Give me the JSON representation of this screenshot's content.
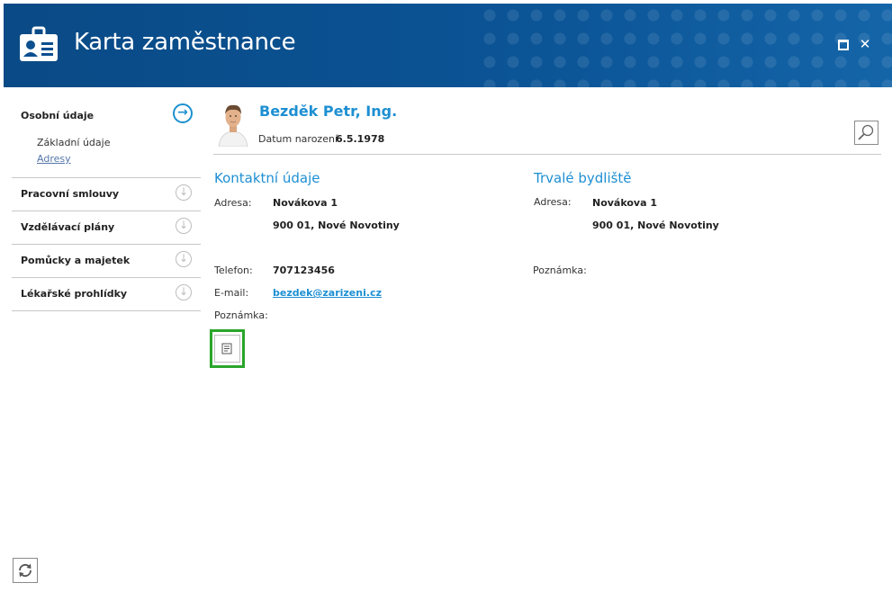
{
  "window": {
    "title": "Karta zaměstnance",
    "maximize_icon": "maximize-icon",
    "close_label": "✕"
  },
  "sidebar": {
    "sections": [
      {
        "label": "Osobní údaje",
        "icon": "arrow-right-circle-icon",
        "active": true,
        "items": [
          {
            "label": "Základní údaje"
          },
          {
            "label": "Adresy"
          }
        ]
      },
      {
        "label": "Pracovní smlouvy",
        "icon": "arrow-down-circle-icon"
      },
      {
        "label": "Vzdělávací plány",
        "icon": "arrow-down-circle-icon"
      },
      {
        "label": "Pomůcky a majetek",
        "icon": "arrow-down-circle-icon"
      },
      {
        "label": "Lékařské prohlídky",
        "icon": "arrow-down-circle-icon"
      }
    ]
  },
  "person": {
    "name": "Bezděk Petr, Ing.",
    "dob_label": "Datum narození:",
    "dob_value": "6.5.1978"
  },
  "contact": {
    "title": "Kontaktní údaje",
    "address_label": "Adresa:",
    "address_line1": "Novákova 1",
    "address_line2": "900 01, Nové Novotiny",
    "phone_label": "Telefon:",
    "phone_value": "707123456",
    "email_label": "E-mail:",
    "email_value": "bezdek@zarizeni.cz",
    "note_label": "Poznámka:"
  },
  "permanent": {
    "title": "Trvalé bydliště",
    "address_label": "Adresa:",
    "address_line1": "Novákova 1",
    "address_line2": "900 01, Nové Novotiny",
    "note_label": "Poznámka:"
  },
  "colors": {
    "accent": "#1d8fd2",
    "header": "#0b4f8f",
    "highlight": "#2aa52a"
  }
}
